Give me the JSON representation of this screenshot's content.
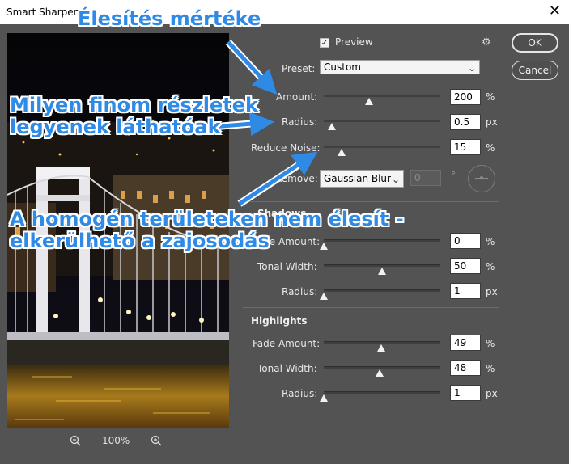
{
  "window": {
    "title": "Smart Sharpen"
  },
  "preview": {
    "checkbox_label": "Preview",
    "checked": true
  },
  "preset": {
    "label": "Preset:",
    "value": "Custom"
  },
  "main": {
    "amount": {
      "label": "Amount:",
      "value": "200",
      "unit": "%",
      "slider_fraction": 0.39
    },
    "radius": {
      "label": "Radius:",
      "value": "0.5",
      "unit": "px",
      "slider_fraction": 0.07
    },
    "reduce_noise": {
      "label": "Reduce Noise:",
      "value": "15",
      "unit": "%",
      "slider_fraction": 0.15
    },
    "remove": {
      "label": "Remove:",
      "value": "Gaussian Blur",
      "angle_value": "0",
      "angle_unit": "°"
    }
  },
  "shadows": {
    "title": "Shadows",
    "fade_amount": {
      "label": "Fade Amount:",
      "value": "0",
      "unit": "%",
      "slider_fraction": 0.0
    },
    "tonal_width": {
      "label": "Tonal Width:",
      "value": "50",
      "unit": "%",
      "slider_fraction": 0.5
    },
    "radius": {
      "label": "Radius:",
      "value": "1",
      "unit": "px",
      "slider_fraction": 0.0
    }
  },
  "highlights": {
    "title": "Highlights",
    "fade_amount": {
      "label": "Fade Amount:",
      "value": "49",
      "unit": "%",
      "slider_fraction": 0.49
    },
    "tonal_width": {
      "label": "Tonal Width:",
      "value": "48",
      "unit": "%",
      "slider_fraction": 0.48
    },
    "radius": {
      "label": "Radius:",
      "value": "1",
      "unit": "px",
      "slider_fraction": 0.0
    }
  },
  "buttons": {
    "ok": "OK",
    "cancel": "Cancel"
  },
  "zoom": {
    "level": "100%"
  },
  "annotations": {
    "amount_note": "Élesítés mértéke",
    "radius_note_line1": "Milyen finom részletek",
    "radius_note_line2": "legyenek láthatóak",
    "noise_note_line1": "A homogén területeken nem élesít -",
    "noise_note_line2": "elkerülhető a zajosodás"
  },
  "colors": {
    "annotation_blue": "#2f8ae6",
    "dialog_bg": "#535353"
  }
}
